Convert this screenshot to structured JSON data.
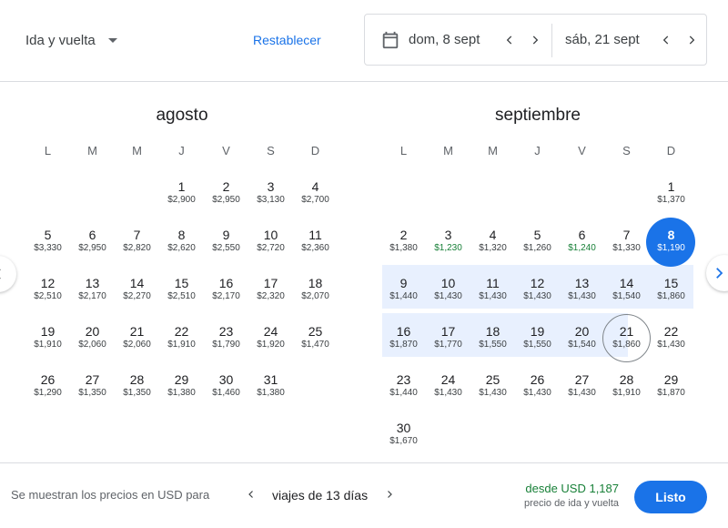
{
  "header": {
    "trip_type": "Ida y vuelta",
    "reset_label": "Restablecer",
    "departure_date": "dom, 8 sept",
    "return_date": "sáb, 21 sept"
  },
  "weekdays": [
    "L",
    "M",
    "M",
    "J",
    "V",
    "S",
    "D"
  ],
  "months": [
    {
      "name": "agosto",
      "first_weekday": 4,
      "days": [
        {
          "day": "1",
          "price": "$2,900"
        },
        {
          "day": "2",
          "price": "$2,950"
        },
        {
          "day": "3",
          "price": "$3,130"
        },
        {
          "day": "4",
          "price": "$2,700"
        },
        {
          "day": "5",
          "price": "$3,330"
        },
        {
          "day": "6",
          "price": "$2,950"
        },
        {
          "day": "7",
          "price": "$2,820"
        },
        {
          "day": "8",
          "price": "$2,620"
        },
        {
          "day": "9",
          "price": "$2,550"
        },
        {
          "day": "10",
          "price": "$2,720"
        },
        {
          "day": "11",
          "price": "$2,360"
        },
        {
          "day": "12",
          "price": "$2,510"
        },
        {
          "day": "13",
          "price": "$2,170"
        },
        {
          "day": "14",
          "price": "$2,270"
        },
        {
          "day": "15",
          "price": "$2,510"
        },
        {
          "day": "16",
          "price": "$2,170"
        },
        {
          "day": "17",
          "price": "$2,320"
        },
        {
          "day": "18",
          "price": "$2,070"
        },
        {
          "day": "19",
          "price": "$1,910"
        },
        {
          "day": "20",
          "price": "$2,060"
        },
        {
          "day": "21",
          "price": "$2,060"
        },
        {
          "day": "22",
          "price": "$1,910"
        },
        {
          "day": "23",
          "price": "$1,790"
        },
        {
          "day": "24",
          "price": "$1,920"
        },
        {
          "day": "25",
          "price": "$1,470"
        },
        {
          "day": "26",
          "price": "$1,290"
        },
        {
          "day": "27",
          "price": "$1,350"
        },
        {
          "day": "28",
          "price": "$1,350"
        },
        {
          "day": "29",
          "price": "$1,380"
        },
        {
          "day": "30",
          "price": "$1,460"
        },
        {
          "day": "31",
          "price": "$1,380"
        }
      ]
    },
    {
      "name": "septiembre",
      "first_weekday": 7,
      "days": [
        {
          "day": "1",
          "price": "$1,370"
        },
        {
          "day": "2",
          "price": "$1,380"
        },
        {
          "day": "3",
          "price": "$1,230",
          "low": true
        },
        {
          "day": "4",
          "price": "$1,320"
        },
        {
          "day": "5",
          "price": "$1,260"
        },
        {
          "day": "6",
          "price": "$1,240",
          "low": true
        },
        {
          "day": "7",
          "price": "$1,330"
        },
        {
          "day": "8",
          "price": "$1,190",
          "selected": "start"
        },
        {
          "day": "9",
          "price": "$1,440"
        },
        {
          "day": "10",
          "price": "$1,430"
        },
        {
          "day": "11",
          "price": "$1,430"
        },
        {
          "day": "12",
          "price": "$1,430"
        },
        {
          "day": "13",
          "price": "$1,430"
        },
        {
          "day": "14",
          "price": "$1,540"
        },
        {
          "day": "15",
          "price": "$1,860"
        },
        {
          "day": "16",
          "price": "$1,870"
        },
        {
          "day": "17",
          "price": "$1,770"
        },
        {
          "day": "18",
          "price": "$1,550"
        },
        {
          "day": "19",
          "price": "$1,550"
        },
        {
          "day": "20",
          "price": "$1,540"
        },
        {
          "day": "21",
          "price": "$1,860",
          "selected": "end"
        },
        {
          "day": "22",
          "price": "$1,430"
        },
        {
          "day": "23",
          "price": "$1,440"
        },
        {
          "day": "24",
          "price": "$1,430"
        },
        {
          "day": "25",
          "price": "$1,430"
        },
        {
          "day": "26",
          "price": "$1,430"
        },
        {
          "day": "27",
          "price": "$1,430"
        },
        {
          "day": "28",
          "price": "$1,910"
        },
        {
          "day": "29",
          "price": "$1,870"
        },
        {
          "day": "30",
          "price": "$1,670"
        }
      ]
    }
  ],
  "footer": {
    "info_text": "Se muestran los precios en USD para",
    "trip_length": "viajes de 13 días",
    "from_price": "desde USD 1,187",
    "from_sub": "precio de ida y vuelta",
    "done_label": "Listo"
  },
  "colors": {
    "accent": "#1a73e8",
    "low_price": "#188038",
    "range_band": "#e8f0fe"
  },
  "icons": [
    "calendar-icon",
    "chevron-left-icon",
    "chevron-right-icon",
    "dropdown-caret-icon"
  ]
}
